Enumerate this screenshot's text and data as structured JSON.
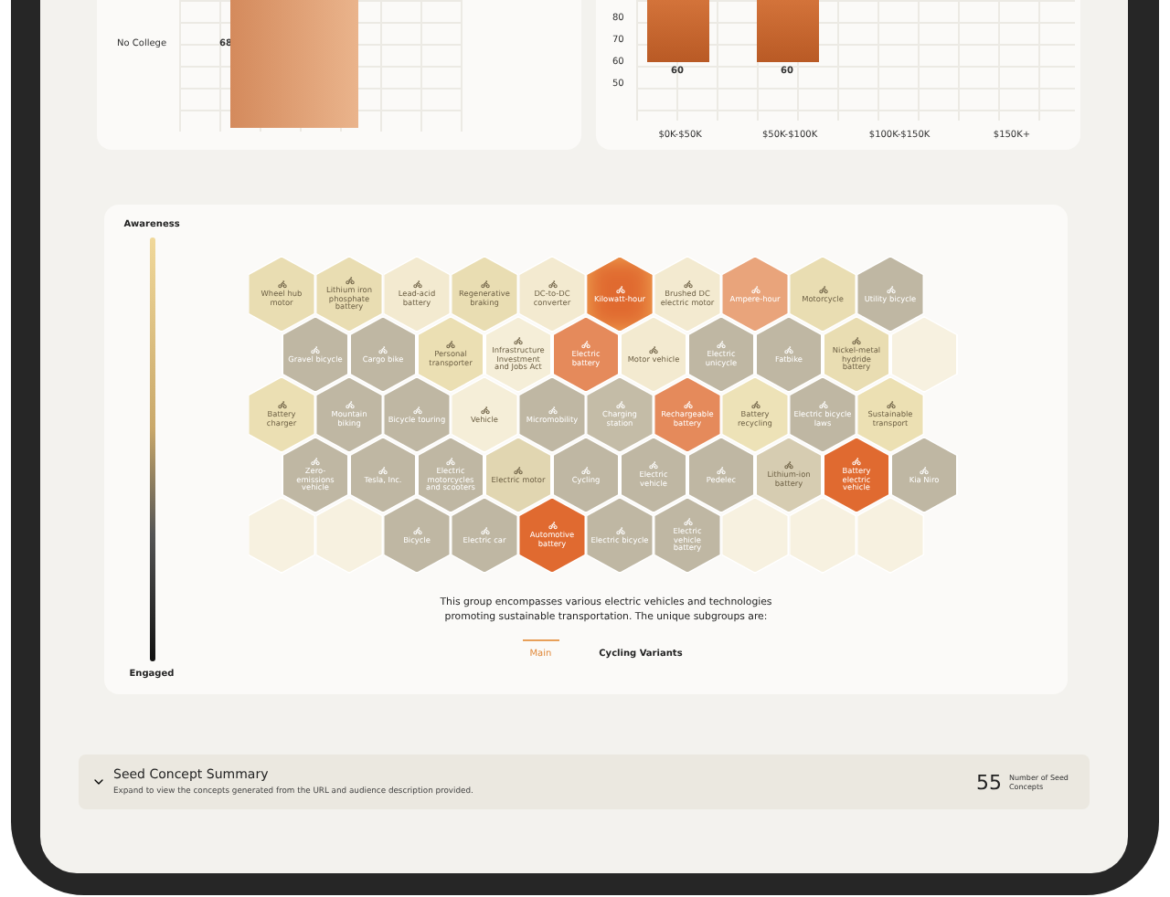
{
  "education_chart": {
    "rows": [
      {
        "label": "No College",
        "value": "68"
      }
    ]
  },
  "income_chart": {
    "yticks": [
      "80",
      "70",
      "60",
      "50"
    ],
    "categories": [
      "$0K-$50K",
      "$50K-$100K",
      "$100K-$150K",
      "$150K+"
    ],
    "bars": [
      {
        "label": "60"
      },
      {
        "label": "60"
      }
    ]
  },
  "concept_map": {
    "legend": {
      "top": "Awareness",
      "bottom": "Engaged"
    },
    "rows": [
      [
        {
          "kind": "concept",
          "label": "Wheel hub motor",
          "color": "#e9ddb2"
        },
        {
          "kind": "concept",
          "label": "Lithium iron phosphate battery",
          "color": "#e9ddb2"
        },
        {
          "kind": "concept",
          "label": "Lead-acid battery",
          "color": "#f3ead0"
        },
        {
          "kind": "concept",
          "label": "Regenerative braking",
          "color": "#e9ddb2"
        },
        {
          "kind": "concept",
          "label": "DC-to-DC converter",
          "color": "#f3ead0"
        },
        {
          "kind": "concept",
          "label": "Kilowatt-hour",
          "color": "#e06a30",
          "highlighted": true
        },
        {
          "kind": "concept",
          "label": "Brushed DC electric motor",
          "color": "#f3ead0"
        },
        {
          "kind": "concept",
          "label": "Ampere-hour",
          "color": "#e9a47b"
        },
        {
          "kind": "concept",
          "label": "Motorcycle",
          "color": "#e9ddb2"
        },
        {
          "kind": "concept",
          "label": "Utility bicycle",
          "color": "#bfb7a3"
        }
      ],
      [
        {
          "kind": "concept",
          "label": "Gravel bicycle",
          "color": "#bfb7a3"
        },
        {
          "kind": "concept",
          "label": "Cargo bike",
          "color": "#bfb7a3"
        },
        {
          "kind": "concept",
          "label": "Personal transporter",
          "color": "#ebdfb3"
        },
        {
          "kind": "concept",
          "label": "Infrastructure Investment and Jobs Act",
          "color": "#f5eed8"
        },
        {
          "kind": "concept",
          "label": "Electric battery",
          "color": "#e58a5b"
        },
        {
          "kind": "concept",
          "label": "Motor vehicle",
          "color": "#f3ead0"
        },
        {
          "kind": "concept",
          "label": "Electric unicycle",
          "color": "#bfb7a3"
        },
        {
          "kind": "concept",
          "label": "Fatbike",
          "color": "#bfb7a3"
        },
        {
          "kind": "concept",
          "label": "Nickel-metal hydride battery",
          "color": "#e9ddb2"
        },
        {
          "kind": "empty",
          "color": "#f7f1e0"
        }
      ],
      [
        {
          "kind": "concept",
          "label": "Battery charger",
          "color": "#ebdfb3"
        },
        {
          "kind": "concept",
          "label": "Mountain biking",
          "color": "#bfb7a3"
        },
        {
          "kind": "concept",
          "label": "Bicycle touring",
          "color": "#bfb7a3"
        },
        {
          "kind": "concept",
          "label": "Vehicle",
          "color": "#f5eed8"
        },
        {
          "kind": "concept",
          "label": "Micromobility",
          "color": "#bfb7a3"
        },
        {
          "kind": "concept",
          "label": "Charging station",
          "color": "#c4bca7"
        },
        {
          "kind": "concept",
          "label": "Rechargeable battery",
          "color": "#e58a5b"
        },
        {
          "kind": "concept",
          "label": "Battery recycling",
          "color": "#ede2b7"
        },
        {
          "kind": "concept",
          "label": "Electric bicycle laws",
          "color": "#bfb7a3"
        },
        {
          "kind": "concept",
          "label": "Sustainable transport",
          "color": "#ece0b3"
        }
      ],
      [
        {
          "kind": "concept",
          "label": "Zero-emissions vehicle",
          "color": "#bfb7a3"
        },
        {
          "kind": "concept",
          "label": "Tesla, Inc.",
          "color": "#bfb7a3"
        },
        {
          "kind": "concept",
          "label": "Electric motorcycles and scooters",
          "color": "#bfb7a3"
        },
        {
          "kind": "concept",
          "label": "Electric motor",
          "color": "#e1d6b1"
        },
        {
          "kind": "concept",
          "label": "Cycling",
          "color": "#bfb7a3"
        },
        {
          "kind": "concept",
          "label": "Electric vehicle",
          "color": "#bfb7a3"
        },
        {
          "kind": "concept",
          "label": "Pedelec",
          "color": "#bfb7a3"
        },
        {
          "kind": "concept",
          "label": "Lithium-ion battery",
          "color": "#d6ccb1"
        },
        {
          "kind": "concept",
          "label": "Battery electric vehicle",
          "color": "#e06a30"
        },
        {
          "kind": "concept",
          "label": "Kia Niro",
          "color": "#bfb7a3"
        }
      ],
      [
        {
          "kind": "empty",
          "color": "#f7f1e0"
        },
        {
          "kind": "empty",
          "color": "#f7f1e0"
        },
        {
          "kind": "concept",
          "label": "Bicycle",
          "color": "#bfb7a3"
        },
        {
          "kind": "concept",
          "label": "Electric car",
          "color": "#bfb7a3"
        },
        {
          "kind": "concept",
          "label": "Automotive battery",
          "color": "#e06a30"
        },
        {
          "kind": "concept",
          "label": "Electric bicycle",
          "color": "#bfb7a3"
        },
        {
          "kind": "concept",
          "label": "Electric vehicle battery",
          "color": "#bfb7a3"
        },
        {
          "kind": "empty",
          "color": "#f7f1e0"
        },
        {
          "kind": "empty",
          "color": "#f7f1e0"
        },
        {
          "kind": "empty",
          "color": "#f7f1e0"
        }
      ]
    ],
    "description": "This group encompasses various electric vehicles and technologies promoting sustainable transportation. The unique subgroups are:",
    "tabs": [
      {
        "label": "Main",
        "selected": true
      },
      {
        "label": "Cycling Variants",
        "selected": false
      }
    ]
  },
  "summary": {
    "title": "Seed Concept Summary",
    "subtitle": "Expand to view the concepts generated from the URL and audience description provided.",
    "count": "55",
    "count_label": "Number of Seed Concepts",
    "expanded": false
  }
}
